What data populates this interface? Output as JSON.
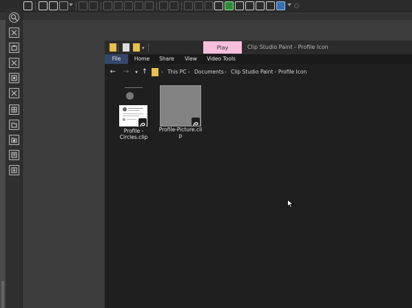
{
  "toolbar": {
    "icons": [
      "command-bar-icon",
      "new-icon",
      "open-icon",
      "save-icon",
      "undo-icon",
      "redo-icon",
      "clear-icon",
      "cut-icon",
      "copy-icon",
      "paste-icon",
      "transform-icon",
      "deselect-icon",
      "invert-selection-icon",
      "show-selection-icon",
      "snap-icon",
      "ruler-icon",
      "help-icon",
      "clip-studio-icon",
      "assets-icon",
      "pen-icon",
      "brush-icon",
      "color-icon",
      "layer-icon"
    ]
  },
  "left_panel": {
    "icons": [
      "zoom-icon",
      "delete-icon",
      "image-icon",
      "delete-icon",
      "star-icon",
      "delete-icon",
      "grid-icon",
      "folder-icon",
      "folder-image-icon",
      "document-icon",
      "import-icon"
    ]
  },
  "explorer": {
    "contextual_tab": "Play",
    "title": "Clip Studio Paint - Profile Icon",
    "ribbon_tabs": [
      {
        "label": "File"
      },
      {
        "label": "Home"
      },
      {
        "label": "Share"
      },
      {
        "label": "View"
      },
      {
        "label": "Video Tools"
      }
    ],
    "breadcrumb": [
      "This PC",
      "Documents",
      "Clip Studio Paint - Profile Icon"
    ],
    "files": [
      {
        "name_line1": "Profile -",
        "name_line2": "Circles.clip",
        "thumbnail": "white-page"
      },
      {
        "name_line1": "Profile-Picture.cli",
        "name_line2": "p",
        "thumbnail": "gray-canvas"
      }
    ]
  },
  "colors": {
    "play_tab": "#f6bfdc",
    "file_tab": "#35466a",
    "explorer_bg": "#1f1f1f",
    "csp_bg": "#3c3c3c"
  }
}
